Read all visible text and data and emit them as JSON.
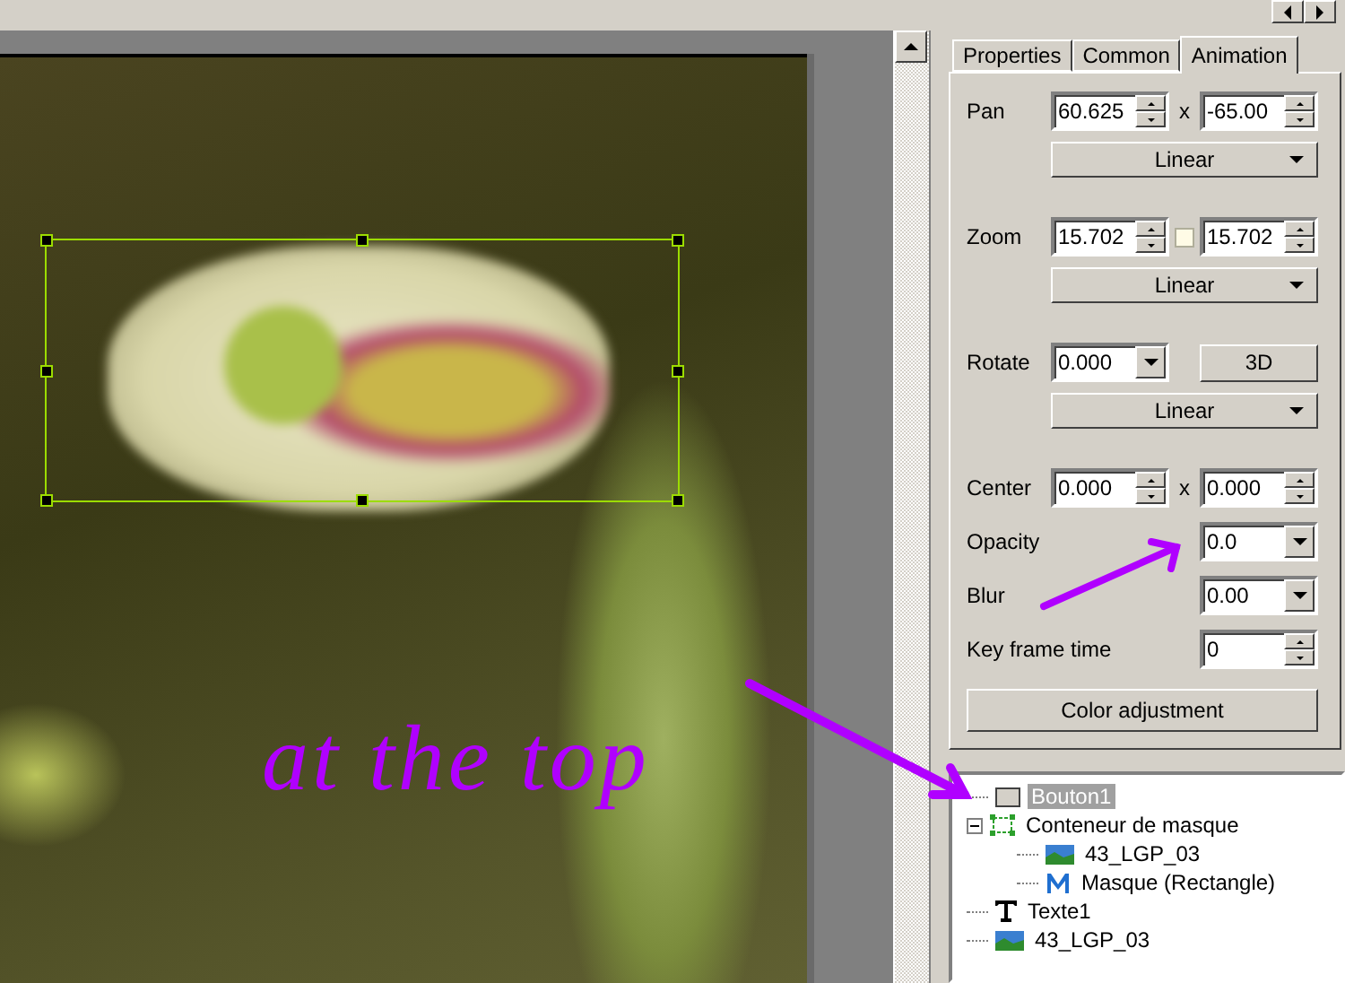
{
  "tabs": [
    {
      "label": "Properties",
      "selected": false
    },
    {
      "label": "Common",
      "selected": false
    },
    {
      "label": "Animation",
      "selected": true
    }
  ],
  "animation_rows": [
    {
      "kind": "pair",
      "label": "Pan",
      "first": {
        "kind": "spinner",
        "value": "60.625"
      },
      "joiner": {
        "kind": "text",
        "text": "x"
      },
      "second": {
        "kind": "spinner",
        "value": "-65.00"
      }
    },
    {
      "kind": "select",
      "value": "Linear"
    },
    {
      "kind": "pair",
      "label": "Zoom",
      "first": {
        "kind": "spinner",
        "value": "15.702"
      },
      "joiner": {
        "kind": "checkbox",
        "checked": false
      },
      "second": {
        "kind": "spinner",
        "value": "15.702"
      }
    },
    {
      "kind": "select",
      "value": "Linear"
    },
    {
      "kind": "pair",
      "label": "Rotate",
      "first": {
        "kind": "combo",
        "value": "0.000"
      },
      "second": {
        "kind": "button",
        "text": "3D"
      }
    },
    {
      "kind": "select",
      "value": "Linear"
    },
    {
      "kind": "pair",
      "label": "Center",
      "first": {
        "kind": "spinner",
        "value": "0.000"
      },
      "joiner": {
        "kind": "text",
        "text": "x"
      },
      "second": {
        "kind": "spinner",
        "value": "0.000"
      }
    },
    {
      "kind": "single",
      "label": "Opacity",
      "control": {
        "kind": "combo",
        "value": "0.0"
      }
    },
    {
      "kind": "single",
      "label": "Blur",
      "control": {
        "kind": "combo",
        "value": "0.00"
      }
    },
    {
      "kind": "single",
      "label": "Key frame time",
      "control": {
        "kind": "spinner",
        "value": "0"
      }
    },
    {
      "kind": "button",
      "text": "Color adjustment"
    }
  ],
  "tree": [
    {
      "label": "Bouton1",
      "kind": "button",
      "selected": true
    },
    {
      "label": "Conteneur de masque",
      "kind": "container",
      "selected": false,
      "expanded": true,
      "children": [
        {
          "label": "43_LGP_03",
          "kind": "image",
          "selected": false
        },
        {
          "label": "Masque (Rectangle)",
          "kind": "mask",
          "selected": false
        }
      ]
    },
    {
      "label": "Texte1",
      "kind": "text",
      "selected": false
    },
    {
      "label": "43_LGP_03",
      "kind": "image",
      "selected": false
    }
  ],
  "annotation": {
    "text": "at the top"
  }
}
